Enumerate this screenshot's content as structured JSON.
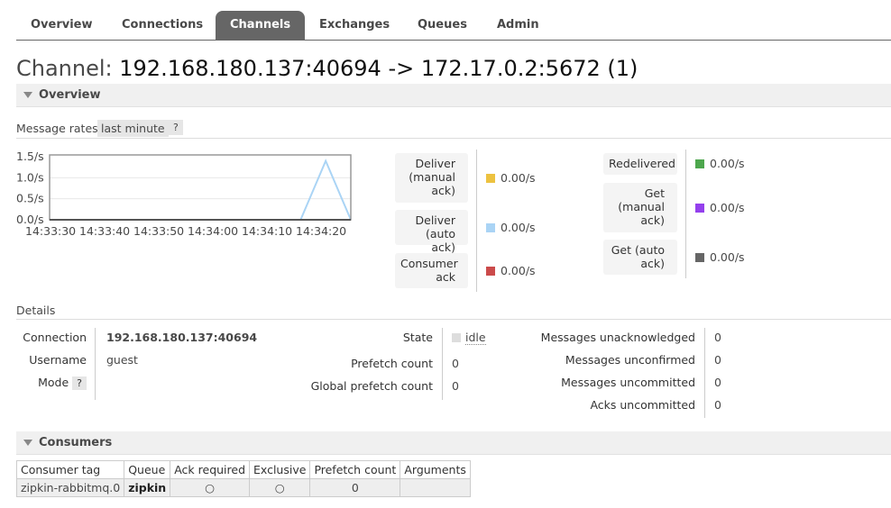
{
  "tabs": [
    "Overview",
    "Connections",
    "Channels",
    "Exchanges",
    "Queues",
    "Admin"
  ],
  "active_tab": "Channels",
  "title": {
    "prefix": "Channel:",
    "name": "192.168.180.137:40694 -> 172.17.0.2:5672 (1)"
  },
  "overview": {
    "header": "Overview",
    "rates_label": "Message rates",
    "rates_period": "last minute",
    "help": "?",
    "chart_data": {
      "type": "line",
      "ylabels": [
        "1.5/s",
        "1.0/s",
        "0.5/s",
        "0.0/s"
      ],
      "ylim": [
        0,
        1.5
      ],
      "x": [
        "14:33:30",
        "14:33:40",
        "14:33:50",
        "14:34:00",
        "14:34:10",
        "14:34:20"
      ],
      "series": [
        {
          "name": "Deliver (auto ack)",
          "color": "#aad4f5",
          "points": [
            [
              0,
              0
            ],
            [
              50,
              0
            ],
            [
              55,
              1.4
            ],
            [
              60,
              0
            ]
          ]
        }
      ],
      "xlim": [
        0,
        60
      ]
    },
    "legend_left": [
      {
        "label": "Deliver (manual ack)",
        "lines": [
          "Deliver",
          "(manual",
          "ack)"
        ],
        "value": "0.00/s",
        "color": "#edc240"
      },
      {
        "label": "Deliver (auto ack)",
        "lines": [
          "Deliver",
          "(auto ack)"
        ],
        "value": "0.00/s",
        "color": "#aad4f5"
      },
      {
        "label": "Consumer ack",
        "lines": [
          "Consumer",
          "ack"
        ],
        "value": "0.00/s",
        "color": "#cb4b4b"
      }
    ],
    "legend_right": [
      {
        "label": "Redelivered",
        "lines": [
          "Redelivered"
        ],
        "value": "0.00/s",
        "color": "#4da74d"
      },
      {
        "label": "Get (manual ack)",
        "lines": [
          "Get",
          "(manual",
          "ack)"
        ],
        "value": "0.00/s",
        "color": "#9440ed"
      },
      {
        "label": "Get (auto ack)",
        "lines": [
          "Get (auto",
          "ack)"
        ],
        "value": "0.00/s",
        "color": "#666666"
      }
    ]
  },
  "details": {
    "header": "Details",
    "connection_label": "Connection",
    "connection": "192.168.180.137:40694",
    "username_label": "Username",
    "username": "guest",
    "mode_label": "Mode",
    "mode_help": "?",
    "state_label": "State",
    "state": "idle",
    "prefetch_label": "Prefetch count",
    "prefetch": "0",
    "global_prefetch_label": "Global prefetch count",
    "global_prefetch": "0",
    "unacked_label": "Messages unacknowledged",
    "unacked": "0",
    "unconfirmed_label": "Messages unconfirmed",
    "unconfirmed": "0",
    "uncommitted_label": "Messages uncommitted",
    "uncommitted": "0",
    "acks_uncommitted_label": "Acks uncommitted",
    "acks_uncommitted": "0"
  },
  "consumers": {
    "header": "Consumers",
    "columns": [
      "Consumer tag",
      "Queue",
      "Ack required",
      "Exclusive",
      "Prefetch count",
      "Arguments"
    ],
    "rows": [
      {
        "tag": "zipkin-rabbitmq.0",
        "queue": "zipkin",
        "ack_required": "○",
        "exclusive": "○",
        "prefetch": "0",
        "arguments": ""
      }
    ]
  }
}
